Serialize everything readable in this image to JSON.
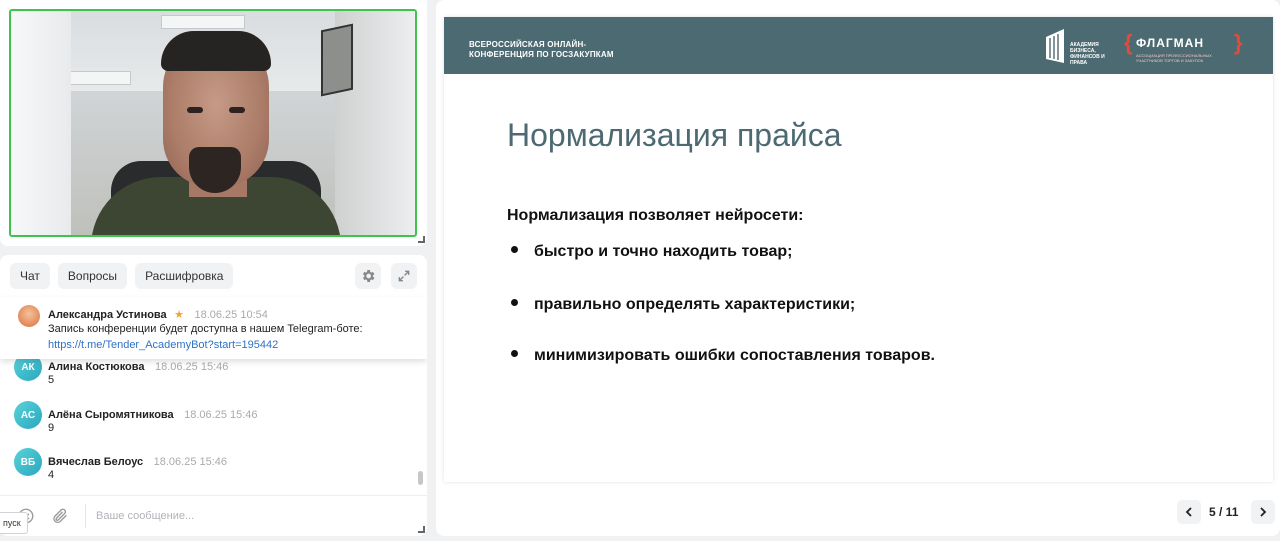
{
  "chat": {
    "tabs": [
      {
        "label": "Чат"
      },
      {
        "label": "Вопросы"
      },
      {
        "label": "Расшифровка"
      }
    ],
    "pinned": {
      "author": "Александра Устинова",
      "star": "★",
      "time": "18.06.25 10:54",
      "text": "Запись конференции будет доступна в нашем Telegram-боте:",
      "link": "https://t.me/Tender_AcademyBot?start=195442"
    },
    "messages": [
      {
        "initials": "АК",
        "author": "Алина Костюкова",
        "time": "18.06.25 15:46",
        "text": "5"
      },
      {
        "initials": "АС",
        "author": "Алёна Сыромятникова",
        "time": "18.06.25 15:46",
        "text": "9"
      },
      {
        "initials": "ВБ",
        "author": "Вячеслав Белоус",
        "time": "18.06.25 15:46",
        "text": "4"
      }
    ],
    "input_placeholder": "Ваше сообщение...",
    "tooltip": "пуск"
  },
  "slide": {
    "header_line1": "ВСЕРОССИЙСКАЯ ОНЛАЙН-",
    "header_line2": "КОНФЕРЕНЦИЯ ПО ГОСЗАКУПКАМ",
    "academy_logo_text": "АКАДЕМИЯ БИЗНЕСА, ФИНАНСОВ И ПРАВА",
    "flagman_logo_name": "ФЛАГМАН",
    "flagman_logo_sub": "АССОЦИАЦИЯ ПРОФЕССИОНАЛЬНЫХ УЧАСТНИКОВ ТОРГОВ И ЗАКУПОК",
    "title": "Нормализация прайса",
    "intro": "Нормализация позволяет нейросети:",
    "bullets": [
      "быстро и точно находить товар;",
      "правильно определять характеристики;",
      "минимизировать ошибки сопоставления товаров."
    ]
  },
  "pager": {
    "label": "5 / 11",
    "current": 5,
    "total": 11
  },
  "colors": {
    "video_border": "#3ec44c",
    "slide_header": "#4c6a72",
    "slide_title": "#4d6a72",
    "link": "#2f72c4",
    "avatar": "#2aa7be",
    "brand_accent": "#e64a3b"
  }
}
